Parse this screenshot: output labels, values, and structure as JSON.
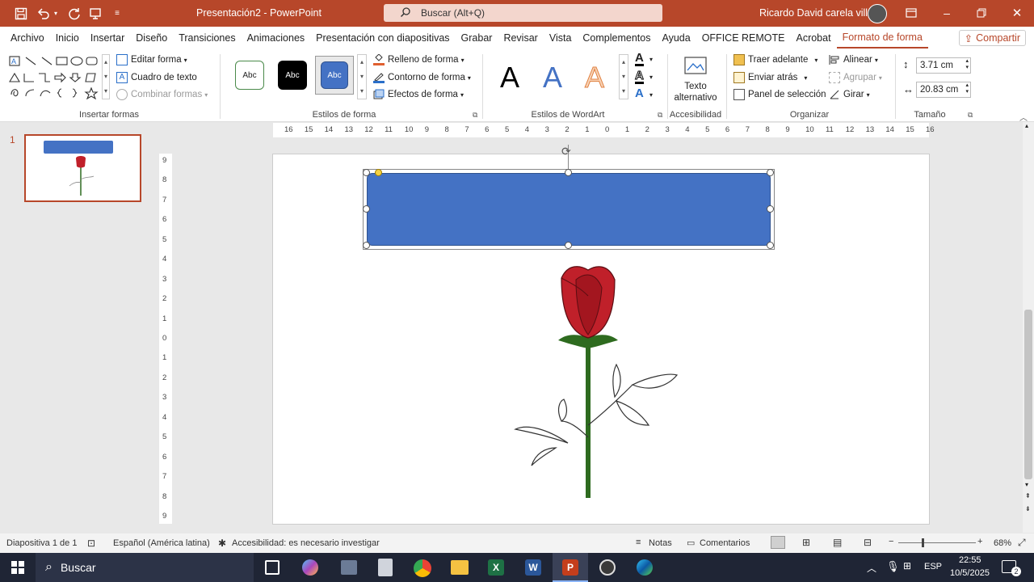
{
  "titlebar": {
    "doc_title": "Presentación2  -  PowerPoint",
    "search_placeholder": "Buscar (Alt+Q)",
    "user_name": "Ricardo David carela villa"
  },
  "menu": {
    "items": [
      "Archivo",
      "Inicio",
      "Insertar",
      "Diseño",
      "Transiciones",
      "Animaciones",
      "Presentación con diapositivas",
      "Grabar",
      "Revisar",
      "Vista",
      "Complementos",
      "Ayuda",
      "OFFICE REMOTE",
      "Acrobat",
      "Formato de forma"
    ],
    "active": "Formato de forma",
    "share": "Compartir"
  },
  "ribbon": {
    "insert_shapes": {
      "label": "Insertar formas",
      "edit_shape": "Editar forma",
      "text_box": "Cuadro de texto",
      "merge_shapes": "Combinar formas"
    },
    "shape_styles": {
      "label": "Estilos de forma",
      "swatch_text": "Abc",
      "fill": "Relleno de forma",
      "outline": "Contorno de forma",
      "effects": "Efectos de forma"
    },
    "wordart": {
      "label": "Estilos de WordArt",
      "sample": "A"
    },
    "accessibility": {
      "label": "Accesibilidad",
      "alt_text_line1": "Texto",
      "alt_text_line2": "alternativo"
    },
    "arrange": {
      "label": "Organizar",
      "bring_forward": "Traer adelante",
      "send_backward": "Enviar atrás",
      "selection_pane": "Panel de selección",
      "align": "Alinear",
      "group": "Agrupar",
      "rotate": "Girar"
    },
    "size": {
      "label": "Tamaño",
      "height": "3.71 cm",
      "width": "20.83 cm"
    }
  },
  "slides": {
    "number": "1"
  },
  "ruler": {
    "horizontal": [
      "16",
      "15",
      "14",
      "13",
      "12",
      "11",
      "10",
      "9",
      "8",
      "7",
      "6",
      "5",
      "4",
      "3",
      "2",
      "1",
      "0",
      "1",
      "2",
      "3",
      "4",
      "5",
      "6",
      "7",
      "8",
      "9",
      "10",
      "11",
      "12",
      "13",
      "14",
      "15",
      "16"
    ],
    "vertical": [
      "9",
      "8",
      "7",
      "6",
      "5",
      "4",
      "3",
      "2",
      "1",
      "0",
      "1",
      "2",
      "3",
      "4",
      "5",
      "6",
      "7",
      "8",
      "9"
    ]
  },
  "status": {
    "slide_info": "Diapositiva 1 de 1",
    "language": "Español (América latina)",
    "accessibility": "Accesibilidad: es necesario investigar",
    "notes": "Notas",
    "comments": "Comentarios",
    "zoom": "68%"
  },
  "taskbar": {
    "search": "Buscar",
    "lang": "ESP",
    "time": "22:55",
    "date": "10/5/2025",
    "notif_count": "2"
  },
  "colors": {
    "accent": "#b7472a",
    "shape_fill": "#4472c4",
    "rose_red": "#c0202a",
    "stem_green": "#2e6b1f"
  }
}
